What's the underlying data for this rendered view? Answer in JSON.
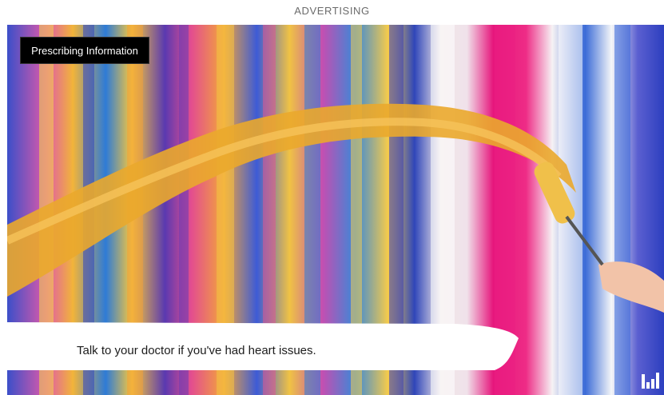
{
  "ad_label": "ADVERTISING",
  "video": {
    "prescribing_button_label": "Prescribing Information",
    "caption": "Talk to your doctor if you've had heart issues.",
    "logo_icon": "bar-chart-logo-icon"
  },
  "colors": {
    "button_bg": "#000000",
    "brush_stroke": "#eaa82c",
    "caption_bg": "#ffffff"
  }
}
